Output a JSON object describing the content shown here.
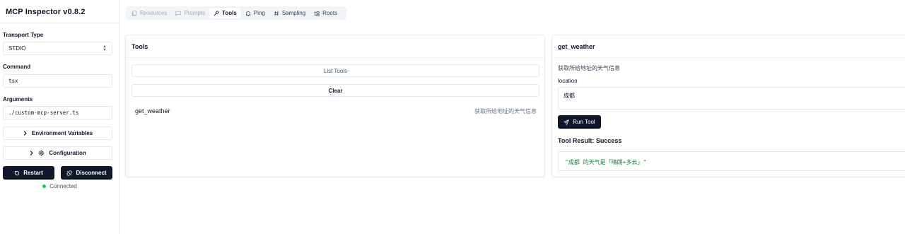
{
  "sidebar": {
    "title": "MCP Inspector v0.8.2",
    "transport_label": "Transport Type",
    "transport_value": "STDIO",
    "command_label": "Command",
    "command_value": "tsx",
    "arguments_label": "Arguments",
    "arguments_value": "./custom-mcp-server.ts",
    "env_vars_label": "Environment Variables",
    "config_label": "Configuration",
    "restart_label": "Restart",
    "disconnect_label": "Disconnect",
    "status_text": "Connected",
    "status_color": "#22c55e"
  },
  "tabs": [
    {
      "label": "Resources",
      "icon": "files-icon",
      "state": "disabled"
    },
    {
      "label": "Prompts",
      "icon": "message-square-icon",
      "state": "disabled"
    },
    {
      "label": "Tools",
      "icon": "hammer-icon",
      "state": "active"
    },
    {
      "label": "Ping",
      "icon": "bell-icon",
      "state": "normal"
    },
    {
      "label": "Sampling",
      "icon": "hash-icon",
      "state": "normal"
    },
    {
      "label": "Roots",
      "icon": "folder-tree-icon",
      "state": "normal"
    }
  ],
  "tools_panel": {
    "title": "Tools",
    "list_tools_label": "List Tools",
    "clear_label": "Clear",
    "tools": [
      {
        "name": "get_weather",
        "description": "获取所给地址的天气信息"
      }
    ]
  },
  "detail_panel": {
    "title": "get_weather",
    "description": "获取所给地址的天气信息",
    "param_label": "location",
    "param_value": "成都",
    "run_label": "Run Tool",
    "result_title": "Tool Result: Success",
    "result_text": "\"成都 的天气是「晴朗+多云」\"",
    "result_color": "#15803d"
  }
}
